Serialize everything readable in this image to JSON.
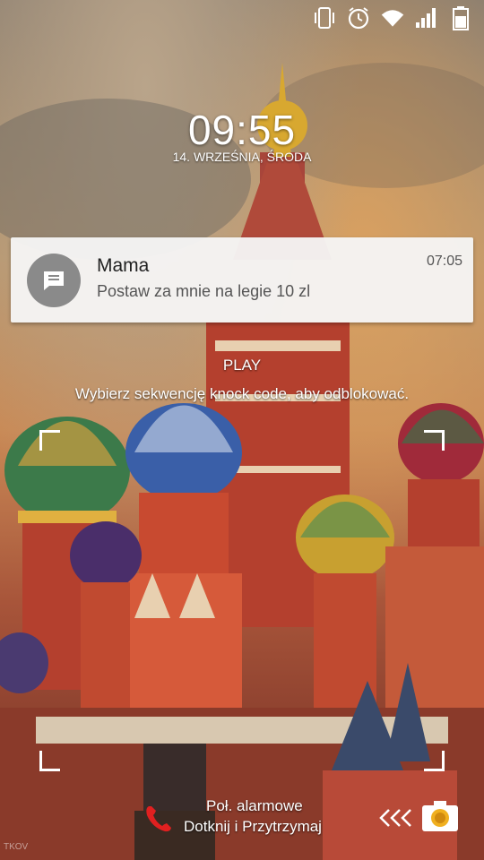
{
  "status_bar": {
    "icons": [
      "vibrate-icon",
      "alarm-clock-icon",
      "wifi-icon",
      "signal-icon",
      "battery-icon"
    ]
  },
  "clock": {
    "time": "09:55",
    "date": "14. WRZEŚNIA, ŚRODA"
  },
  "notification": {
    "title": "Mama",
    "text": "Postaw za mnie na legie 10 zl",
    "time": "07:05",
    "icon": "message-icon"
  },
  "lock": {
    "owner_label": "PLAY",
    "hint": "Wybierz sekwencję knock code, aby odblokować."
  },
  "bottom": {
    "alarm_line1": "Poł. alarmowe",
    "alarm_line2": "Dotknij i Przytrzymaj",
    "camera_icon": "camera-icon",
    "watermark": "TKOV"
  },
  "colors": {
    "notification_bg": "#f6f6f6",
    "avatar_bg": "#8a8a8a",
    "alarm_red": "#e02020"
  }
}
